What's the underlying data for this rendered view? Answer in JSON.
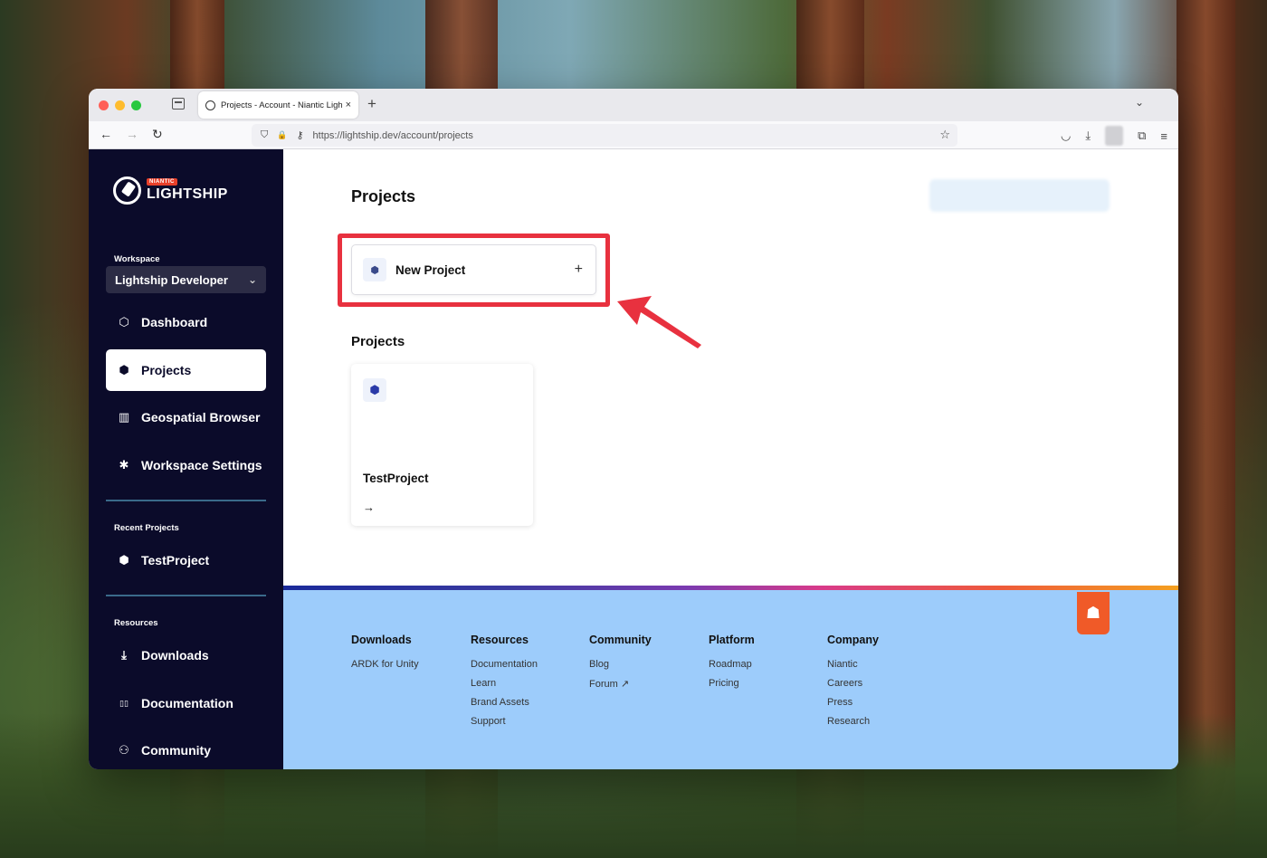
{
  "browser": {
    "tab_title": "Projects - Account - Niantic Lightship",
    "url": "https://lightship.dev/account/projects",
    "new_tab_icon": "+",
    "tab_close_icon": "×",
    "tab_list_icon": "⌄",
    "back_icon": "←",
    "forward_icon": "→",
    "reload_icon": "↻",
    "shield_icon": "⛉",
    "lock_icon": "🔒",
    "key_icon": "⚷",
    "bookmark_icon": "☆",
    "pocket_icon": "◡",
    "download_icon": "⤓",
    "extensions_icon": "⧉",
    "menu_icon": "≡"
  },
  "sidebar": {
    "logo_badge": "NIANTIC",
    "logo_text": "LIGHTSHIP",
    "workspace_label": "Workspace",
    "workspace_value": "Lightship Developer",
    "workspace_chevron": "⌄",
    "nav": [
      {
        "label": "Dashboard",
        "icon": "cube-icon",
        "glyph": "⬡"
      },
      {
        "label": "Projects",
        "icon": "projects-icon",
        "glyph": "⬢"
      },
      {
        "label": "Geospatial Browser",
        "icon": "map-icon",
        "glyph": "▥"
      },
      {
        "label": "Workspace Settings",
        "icon": "gear-icon",
        "glyph": "✱"
      }
    ],
    "recent_label": "Recent Projects",
    "recent": [
      {
        "label": "TestProject",
        "icon": "unity-icon",
        "glyph": "⬢"
      }
    ],
    "resources_label": "Resources",
    "resources": [
      {
        "label": "Downloads",
        "icon": "download-icon",
        "glyph": "⤓"
      },
      {
        "label": "Documentation",
        "icon": "book-icon",
        "glyph": "▯▯"
      },
      {
        "label": "Community",
        "icon": "people-icon",
        "glyph": "⚇"
      }
    ]
  },
  "main": {
    "title": "Projects",
    "new_project_label": "New Project",
    "new_project_icon": "⬢",
    "new_project_plus": "+",
    "section_title": "Projects",
    "projects": [
      {
        "name": "TestProject",
        "icon": "⬢",
        "arrow": "→"
      }
    ]
  },
  "footer": {
    "badge_icon": "☗",
    "columns": [
      {
        "title": "Downloads",
        "links": [
          "ARDK for Unity"
        ]
      },
      {
        "title": "Resources",
        "links": [
          "Documentation",
          "Learn",
          "Brand Assets",
          "Support"
        ]
      },
      {
        "title": "Community",
        "links": [
          "Blog",
          "Forum ↗"
        ]
      },
      {
        "title": "Platform",
        "links": [
          "Roadmap",
          "Pricing"
        ]
      },
      {
        "title": "Company",
        "links": [
          "Niantic",
          "Careers",
          "Press",
          "Research"
        ]
      }
    ]
  },
  "colors": {
    "sidebar_bg": "#0b0b2a",
    "highlight": "#e8313f",
    "footer_bg": "#9dccfb",
    "accent_orange": "#f05a28"
  }
}
